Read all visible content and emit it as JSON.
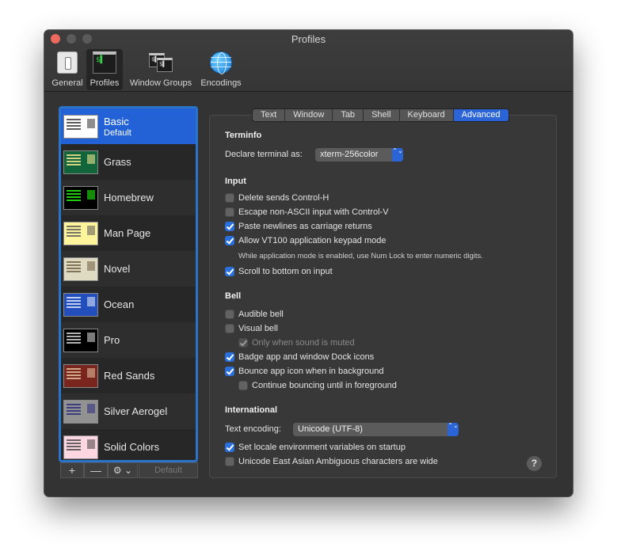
{
  "window": {
    "title": "Profiles"
  },
  "toolbar": [
    {
      "label": "General",
      "icon": "general-icon"
    },
    {
      "label": "Profiles",
      "icon": "terminal-profiles-icon",
      "selected": true
    },
    {
      "label": "Window Groups",
      "icon": "window-groups-icon"
    },
    {
      "label": "Encodings",
      "icon": "globe-icon"
    }
  ],
  "profiles": [
    {
      "name": "Basic",
      "sub": "Default",
      "selected": true,
      "bg": "#ffffff",
      "fg": "#333333"
    },
    {
      "name": "Grass",
      "bg": "#12643a",
      "fg": "#ffef9a"
    },
    {
      "name": "Homebrew",
      "bg": "#000000",
      "fg": "#28fe14"
    },
    {
      "name": "Man Page",
      "bg": "#fef49c",
      "fg": "#555555"
    },
    {
      "name": "Novel",
      "bg": "#dfdbc3",
      "fg": "#6b5a3e"
    },
    {
      "name": "Ocean",
      "bg": "#224fbc",
      "fg": "#e8f0ff"
    },
    {
      "name": "Pro",
      "bg": "#000000",
      "fg": "#e0e0e0"
    },
    {
      "name": "Red Sands",
      "bg": "#7a251e",
      "fg": "#e8c9a4"
    },
    {
      "name": "Silver Aerogel",
      "bg": "#929292",
      "fg": "#2a2a7a"
    },
    {
      "name": "Solid Colors",
      "bg": "#fcd6e0",
      "fg": "#444444"
    }
  ],
  "list_controls": {
    "add": "+",
    "remove": "—",
    "gear": "⚙ ⌄",
    "default": "Default"
  },
  "tabs": [
    {
      "label": "Text"
    },
    {
      "label": "Window"
    },
    {
      "label": "Tab"
    },
    {
      "label": "Shell"
    },
    {
      "label": "Keyboard"
    },
    {
      "label": "Advanced",
      "active": true
    }
  ],
  "terminfo": {
    "title": "Terminfo",
    "declare_label": "Declare terminal as:",
    "declare_value": "xterm-256color"
  },
  "input": {
    "title": "Input",
    "delete_ctrl_h": "Delete sends Control-H",
    "escape_non_ascii": "Escape non-ASCII input with Control-V",
    "paste_newlines": "Paste newlines as carriage returns",
    "vt100_keypad": "Allow VT100 application keypad mode",
    "vt100_note": "While application mode is enabled, use Num Lock to enter numeric digits.",
    "scroll_bottom": "Scroll to bottom on input"
  },
  "bell": {
    "title": "Bell",
    "audible": "Audible bell",
    "visual": "Visual bell",
    "only_muted": "Only when sound is muted",
    "badge_icons": "Badge app and window Dock icons",
    "bounce_icon": "Bounce app icon when in background",
    "continue_bouncing": "Continue bouncing until in foreground"
  },
  "international": {
    "title": "International",
    "encoding_label": "Text encoding:",
    "encoding_value": "Unicode (UTF-8)",
    "set_locale": "Set locale environment variables on startup",
    "east_asian": "Unicode East Asian Ambiguous characters are wide"
  },
  "help": "?",
  "select_arrows": "⌃⌄"
}
